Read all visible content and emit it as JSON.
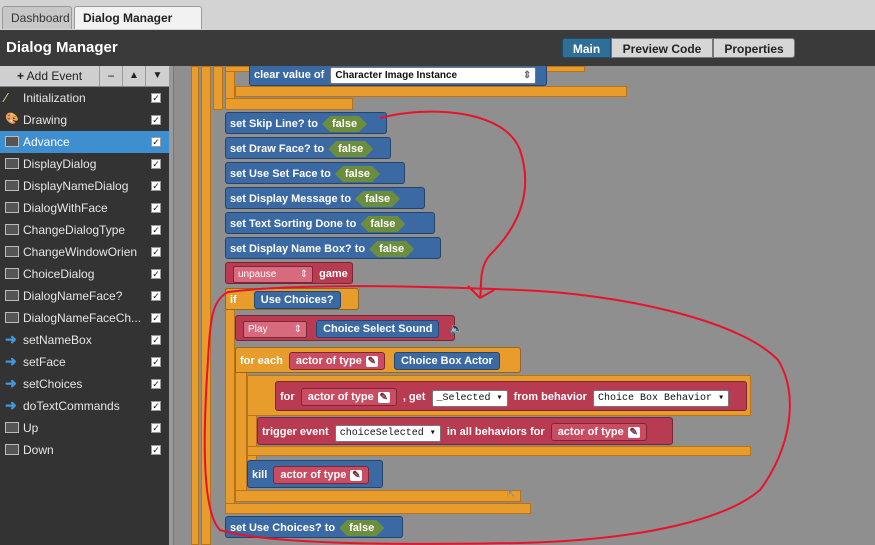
{
  "tabs": [
    {
      "label": "Dashboard",
      "active": false
    },
    {
      "label": "Dialog Manager",
      "active": true,
      "close": "✕"
    }
  ],
  "header": {
    "title": "Dialog Manager",
    "views": [
      {
        "label": "Main",
        "active": true
      },
      {
        "label": "Preview Code",
        "active": false
      },
      {
        "label": "Properties",
        "active": false
      }
    ]
  },
  "sidebar": {
    "add_event": "Add Event",
    "remove_glyph": "−",
    "up_glyph": "▲",
    "down_glyph": "▼",
    "items": [
      {
        "label": "Initialization",
        "icon": "wand-icon",
        "selected": false
      },
      {
        "label": "Drawing",
        "icon": "palette-icon",
        "selected": false
      },
      {
        "label": "Advance",
        "icon": "scene-icon",
        "selected": true
      },
      {
        "label": "DisplayDialog",
        "icon": "scene-icon",
        "selected": false
      },
      {
        "label": "DisplayNameDialog",
        "icon": "scene-icon",
        "selected": false
      },
      {
        "label": "DialogWithFace",
        "icon": "scene-icon",
        "selected": false
      },
      {
        "label": "ChangeDialogType",
        "icon": "scene-icon",
        "selected": false
      },
      {
        "label": "ChangeWindowOrien",
        "icon": "scene-icon",
        "selected": false
      },
      {
        "label": "ChoiceDialog",
        "icon": "scene-icon",
        "selected": false
      },
      {
        "label": "DialogNameFace?",
        "icon": "scene-icon",
        "selected": false
      },
      {
        "label": "DialogNameFaceCh...",
        "icon": "scene-icon",
        "selected": false
      },
      {
        "label": "setNameBox",
        "icon": "arrow-icon",
        "selected": false
      },
      {
        "label": "setFace",
        "icon": "arrow-icon",
        "selected": false
      },
      {
        "label": "setChoices",
        "icon": "arrow-icon",
        "selected": false
      },
      {
        "label": "doTextCommands",
        "icon": "arrow-icon",
        "selected": false
      },
      {
        "label": "Up",
        "icon": "scene-icon",
        "selected": false
      },
      {
        "label": "Down",
        "icon": "scene-icon",
        "selected": false
      }
    ]
  },
  "blocks": {
    "clear_value_of": "clear value of",
    "character_image_instance": "Character Image Instance",
    "set_skip_line": "set Skip Line? to",
    "set_draw_face": "set Draw Face? to",
    "set_use_set_face": "set Use Set Face to",
    "set_display_message": "set Display Message to",
    "set_text_sorting_done": "set Text Sorting Done to",
    "set_display_name_box": "set Display Name Box? to",
    "false_literal": "false",
    "unpause": "unpause",
    "game": "game",
    "if": "if",
    "use_choices": "Use Choices?",
    "play": "Play",
    "choice_select_sound": "Choice Select Sound",
    "for_each": "for each",
    "actor_of_type": "actor of type",
    "choice_box_actor": "Choice Box Actor",
    "for": "for",
    "get": ", get",
    "selected_attr": "_Selected",
    "from_behavior": "from behavior",
    "choice_box_behavior": "Choice Box Behavior",
    "trigger_event": "trigger event",
    "choice_selected": "choiceSelected",
    "in_all_behaviors_for": "in all behaviors for",
    "kill": "kill",
    "set_use_choices": "set Use Choices? to"
  },
  "colors": {
    "blue_block": "#3b69a3",
    "red_block": "#b83b52",
    "orange_block": "#e89c2c",
    "green_literal": "#6c8d3e",
    "annotation": "#e8122a"
  }
}
